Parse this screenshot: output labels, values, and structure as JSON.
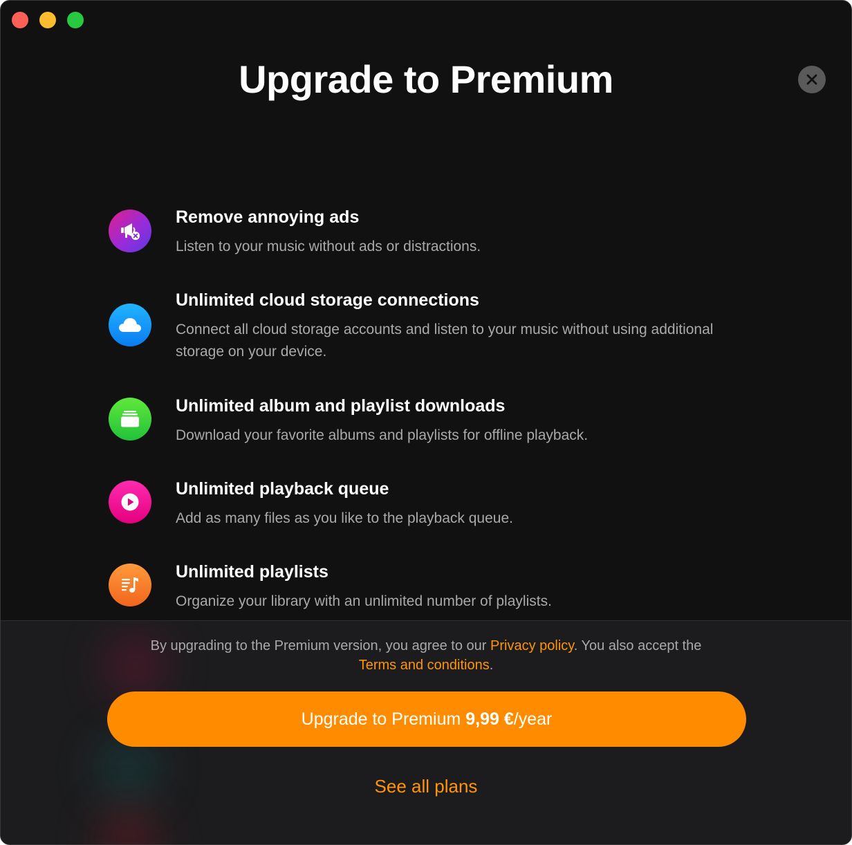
{
  "window": {
    "controls": [
      "close",
      "minimize",
      "zoom"
    ]
  },
  "header": {
    "title": "Upgrade to Premium",
    "close_icon": "close-icon"
  },
  "features": [
    {
      "icon": "megaphone-no-ads-icon",
      "title": "Remove annoying ads",
      "description": "Listen to your music without ads or distractions."
    },
    {
      "icon": "cloud-icon",
      "title": "Unlimited cloud storage connections",
      "description": "Connect all cloud storage accounts and listen to your music without using additional storage on your device."
    },
    {
      "icon": "album-stack-icon",
      "title": "Unlimited album and playlist downloads",
      "description": "Download your favorite albums and playlists for offline playback."
    },
    {
      "icon": "play-circle-icon",
      "title": "Unlimited playback queue",
      "description": "Add as many files as you like to the playback queue."
    },
    {
      "icon": "playlist-music-icon",
      "title": "Unlimited playlists",
      "description": "Organize your library with an unlimited number of playlists."
    }
  ],
  "footer": {
    "legal_prefix": "By upgrading to the Premium version, you agree to our ",
    "privacy_link": "Privacy policy",
    "legal_middle": ". You also accept the ",
    "terms_link": "Terms and conditions",
    "legal_suffix": ".",
    "upgrade_label": "Upgrade to Premium",
    "upgrade_price": "9,99 €",
    "upgrade_period": "/year",
    "see_all_plans": "See all plans"
  },
  "colors": {
    "accent": "#ff8c00",
    "link": "#ff9408",
    "background": "#111111",
    "footer_background": "#1c1c1e"
  }
}
